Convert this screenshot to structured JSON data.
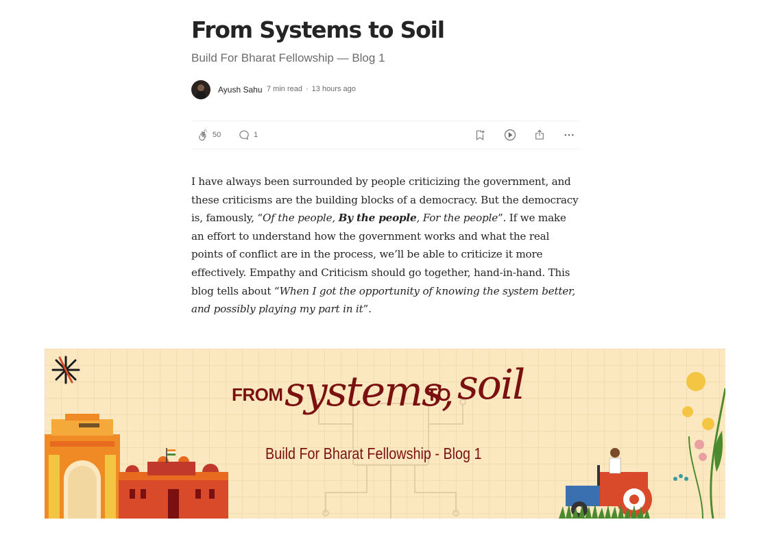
{
  "article": {
    "title": "From Systems to Soil",
    "subtitle": "Build For Bharat Fellowship — Blog 1",
    "author": "Ayush Sahu",
    "read_time": "7 min read",
    "separator": "·",
    "published": "13 hours ago"
  },
  "actions": {
    "claps": "50",
    "responses": "1",
    "icons": [
      "clap-icon",
      "comment-icon",
      "bookmark-icon",
      "listen-icon",
      "share-icon",
      "more-icon"
    ]
  },
  "body": {
    "t1": "I have always been surrounded by people criticizing the government, and these criticisms are the building blocks of a democracy. But the democracy is, famously, “",
    "q1a": "Of the people, ",
    "q1b": "By the people",
    "q1c": ", For the people",
    "t2": "”. If we make an effort to understand how the government works and what the real points of conflict are in the process, we’ll be able to criticize it more effectively. Empathy and Criticism should go together, hand-in-hand. This blog tells about “",
    "q2": "When I got the opportunity of knowing the system better, and possibly playing my part in it",
    "t3": "”."
  },
  "banner": {
    "from": "FROM",
    "systems": "systems,",
    "to": "TO",
    "soil": "soil",
    "subtitle": "Build For Bharat Fellowship - Blog 1",
    "colors": {
      "background": "#fbe8c0",
      "text": "#7a1010",
      "saffron": "#f08a24",
      "red": "#d94a2a",
      "green": "#4b8a2e"
    }
  }
}
